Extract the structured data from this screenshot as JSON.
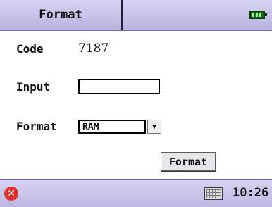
{
  "header": {
    "title": "Format"
  },
  "form": {
    "code_label": "Code",
    "code_value": "7187",
    "input_label": "Input",
    "input_value": "",
    "format_label": "Format",
    "format_selected": "RAM"
  },
  "actions": {
    "format_button": "Format"
  },
  "taskbar": {
    "time": "10:26"
  },
  "colors": {
    "bar_bg": "#c7c2ea",
    "close": "#e0302c",
    "battery": "#0b6e0b"
  }
}
